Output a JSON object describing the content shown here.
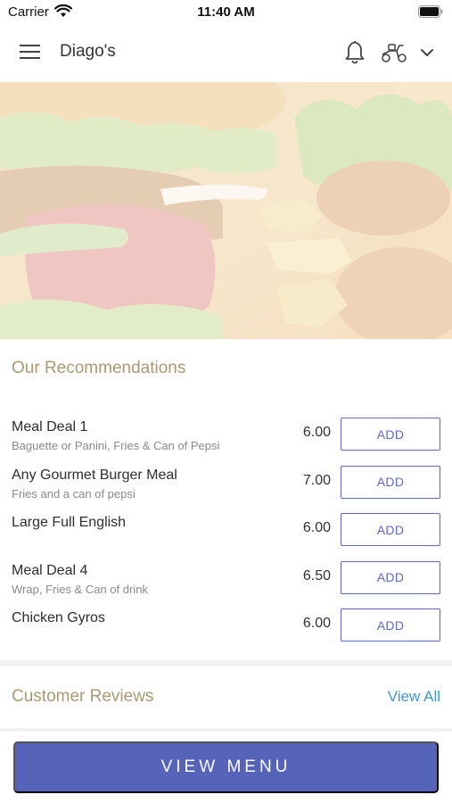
{
  "status_bar": {
    "carrier": "Carrier",
    "time": "11:40 AM"
  },
  "header": {
    "title": "Diago's"
  },
  "recommendations": {
    "title": "Our Recommendations",
    "items": [
      {
        "name": "Meal Deal 1",
        "description": "Baguette or Panini, Fries & Can of Pepsi",
        "price": "6.00",
        "button": "ADD"
      },
      {
        "name": "Any Gourmet Burger Meal",
        "description": "Fries and a can of pepsi",
        "price": "7.00",
        "button": "ADD"
      },
      {
        "name": "Large Full English",
        "description": "",
        "price": "6.00",
        "button": "ADD"
      },
      {
        "name": "Meal Deal 4",
        "description": "Wrap, Fries & Can of drink",
        "price": "6.50",
        "button": "ADD"
      },
      {
        "name": "Chicken Gyros",
        "description": "",
        "price": "6.00",
        "button": "ADD"
      }
    ]
  },
  "reviews": {
    "title": "Customer Reviews",
    "view_all": "View All"
  },
  "footer": {
    "view_menu": "VIEW MENU"
  },
  "colors": {
    "accent": "#5563b8",
    "section_title": "#a89a72",
    "link": "#3f99c8"
  },
  "icons": [
    "wifi-icon",
    "battery-icon",
    "hamburger-menu-icon",
    "bell-icon",
    "scooter-icon",
    "chevron-down-icon"
  ]
}
